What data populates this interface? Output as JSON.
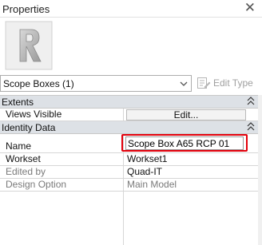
{
  "panel": {
    "title": "Properties"
  },
  "type_selector": {
    "value": "Scope Boxes (1)",
    "edit_type_label": "Edit Type"
  },
  "groups": [
    {
      "label": "Extents"
    },
    {
      "label": "Identity Data"
    }
  ],
  "extents": {
    "views_visible": {
      "name": "Views Visible",
      "button": "Edit..."
    }
  },
  "identity": {
    "name": {
      "label": "Name",
      "value": "Scope Box A65 RCP 01"
    },
    "workset": {
      "label": "Workset",
      "value": "Workset1"
    },
    "edited_by": {
      "label": "Edited by",
      "value": "Quad-IT"
    },
    "design_option": {
      "label": "Design Option",
      "value": "Main Model"
    }
  },
  "colors": {
    "highlight": "#e3000b",
    "group_header_bg": "#dde1e6"
  }
}
